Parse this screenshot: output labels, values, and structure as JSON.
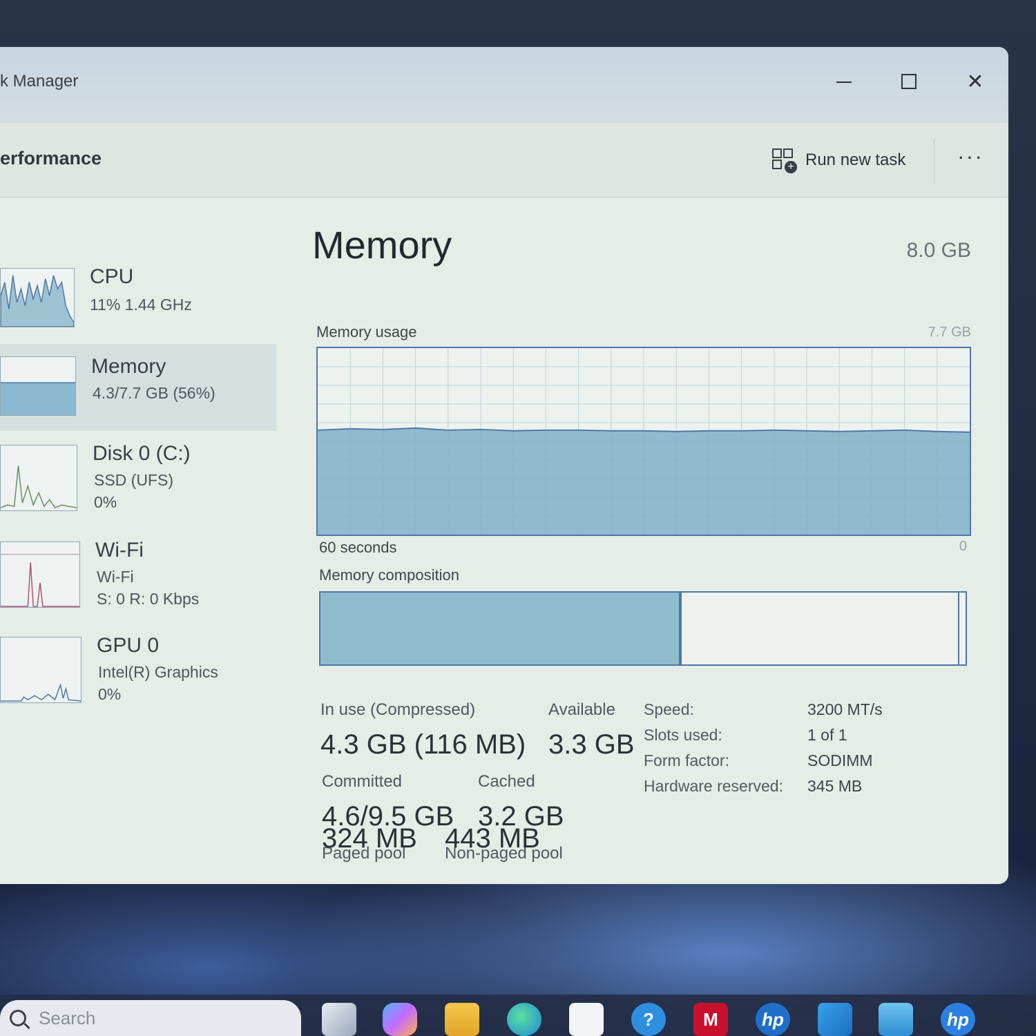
{
  "window": {
    "title": "k Manager",
    "controls": {
      "minimize": "",
      "maximize": "",
      "close": "✕"
    }
  },
  "header": {
    "page_title": "erformance",
    "run_new_task": "Run new task",
    "more": "···"
  },
  "sidebar": {
    "items": [
      {
        "name": "CPU",
        "lines": [
          "11%  1.44 GHz"
        ]
      },
      {
        "name": "Memory",
        "lines": [
          "4.3/7.7 GB (56%)"
        ],
        "selected": true
      },
      {
        "name": "Disk 0 (C:)",
        "lines": [
          "SSD (UFS)",
          "0%"
        ]
      },
      {
        "name": "Wi-Fi",
        "lines": [
          "Wi-Fi",
          "S: 0  R: 0 Kbps"
        ]
      },
      {
        "name": "GPU 0",
        "lines": [
          "Intel(R) Graphics",
          "0%"
        ]
      }
    ]
  },
  "memory": {
    "title": "Memory",
    "total": "8.0 GB",
    "usage_label": "Memory usage",
    "usage_max": "7.7 GB",
    "time_span": "60 seconds",
    "time_end": "0",
    "composition_label": "Memory composition",
    "usage_fraction": 0.56,
    "composition": {
      "in_use": 0.56,
      "available": 0.43
    },
    "stats": {
      "in_use_label": "In use (Compressed)",
      "in_use_value": "4.3 GB (116 MB)",
      "available_label": "Available",
      "available_value": "3.3 GB",
      "committed_label": "Committed",
      "committed_value": "4.6/9.5 GB",
      "cached_label": "Cached",
      "cached_value": "3.2 GB",
      "paged_label": "Paged pool",
      "paged_value": "324 MB",
      "nonpaged_label": "Non-paged pool",
      "nonpaged_value": "443 MB"
    },
    "specs": [
      {
        "label": "Speed:",
        "value": "3200 MT/s"
      },
      {
        "label": "Slots used:",
        "value": "1 of 1"
      },
      {
        "label": "Form factor:",
        "value": "SODIMM"
      },
      {
        "label": "Hardware reserved:",
        "value": "345 MB"
      }
    ]
  },
  "taskbar": {
    "search_placeholder": "Search",
    "icons": [
      "task-view-icon",
      "copilot-icon",
      "file-explorer-icon",
      "edge-icon",
      "store-icon",
      "help-icon",
      "mcafee-icon",
      "hp-icon",
      "mail-icon",
      "photos-icon",
      "hp-support-icon"
    ]
  },
  "colors": {
    "accent": "#4d76a8",
    "memory_fill": "#7fb2c9",
    "window_bg": "#e6ece6"
  }
}
